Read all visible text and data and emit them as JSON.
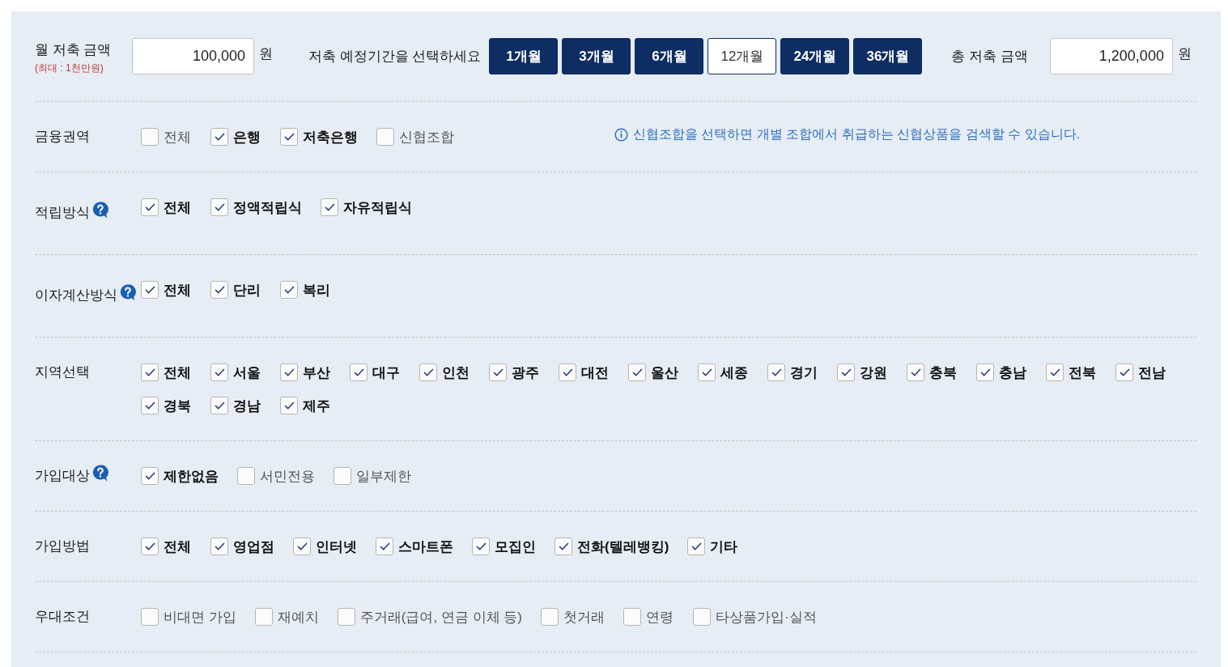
{
  "savings": {
    "monthly": {
      "label": "월 저축 금액",
      "note": "(최대 : 1천만원)",
      "value": "100,000",
      "unit": "원"
    },
    "period": {
      "label": "저축 예정기간을 선택하세요",
      "options": [
        {
          "label": "1개월",
          "selected": false
        },
        {
          "label": "3개월",
          "selected": false
        },
        {
          "label": "6개월",
          "selected": false
        },
        {
          "label": "12개월",
          "selected": true
        },
        {
          "label": "24개월",
          "selected": false
        },
        {
          "label": "36개월",
          "selected": false
        }
      ]
    },
    "total": {
      "label": "총 저축 금액",
      "value": "1,200,000",
      "unit": "원"
    }
  },
  "filters": [
    {
      "label": "금융권역",
      "help": false,
      "options": [
        {
          "label": "전체",
          "checked": false
        },
        {
          "label": "은행",
          "checked": true
        },
        {
          "label": "저축은행",
          "checked": true
        },
        {
          "label": "신협조합",
          "checked": false
        }
      ],
      "note": "신협조합을 선택하면 개별 조합에서 취급하는 신협상품을 검색할 수 있습니다."
    },
    {
      "label": "적립방식",
      "help": true,
      "options": [
        {
          "label": "전체",
          "checked": true
        },
        {
          "label": "정액적립식",
          "checked": true
        },
        {
          "label": "자유적립식",
          "checked": true
        }
      ]
    },
    {
      "label": "이자계산방식",
      "help": true,
      "options": [
        {
          "label": "전체",
          "checked": true
        },
        {
          "label": "단리",
          "checked": true
        },
        {
          "label": "복리",
          "checked": true
        }
      ]
    },
    {
      "label": "지역선택",
      "help": false,
      "options": [
        {
          "label": "전체",
          "checked": true
        },
        {
          "label": "서울",
          "checked": true
        },
        {
          "label": "부산",
          "checked": true
        },
        {
          "label": "대구",
          "checked": true
        },
        {
          "label": "인천",
          "checked": true
        },
        {
          "label": "광주",
          "checked": true
        },
        {
          "label": "대전",
          "checked": true
        },
        {
          "label": "울산",
          "checked": true
        },
        {
          "label": "세종",
          "checked": true
        },
        {
          "label": "경기",
          "checked": true
        },
        {
          "label": "강원",
          "checked": true
        },
        {
          "label": "충북",
          "checked": true
        },
        {
          "label": "충남",
          "checked": true
        },
        {
          "label": "전북",
          "checked": true
        },
        {
          "label": "전남",
          "checked": true
        },
        {
          "label": "경북",
          "checked": true
        },
        {
          "label": "경남",
          "checked": true
        },
        {
          "label": "제주",
          "checked": true
        }
      ]
    },
    {
      "label": "가입대상",
      "help": true,
      "options": [
        {
          "label": "제한없음",
          "checked": true
        },
        {
          "label": "서민전용",
          "checked": false
        },
        {
          "label": "일부제한",
          "checked": false
        }
      ]
    },
    {
      "label": "가입방법",
      "help": false,
      "options": [
        {
          "label": "전체",
          "checked": true
        },
        {
          "label": "영업점",
          "checked": true
        },
        {
          "label": "인터넷",
          "checked": true
        },
        {
          "label": "스마트폰",
          "checked": true
        },
        {
          "label": "모집인",
          "checked": true
        },
        {
          "label": "전화(텔레뱅킹)",
          "checked": true
        },
        {
          "label": "기타",
          "checked": true
        }
      ]
    },
    {
      "label": "우대조건",
      "help": false,
      "options": [
        {
          "label": "비대면 가입",
          "checked": false
        },
        {
          "label": "재예치",
          "checked": false
        },
        {
          "label": "주거래(급여, 연금 이체 등)",
          "checked": false
        },
        {
          "label": "첫거래",
          "checked": false
        },
        {
          "label": "연령",
          "checked": false
        },
        {
          "label": "타상품가입·실적",
          "checked": false
        }
      ]
    }
  ]
}
